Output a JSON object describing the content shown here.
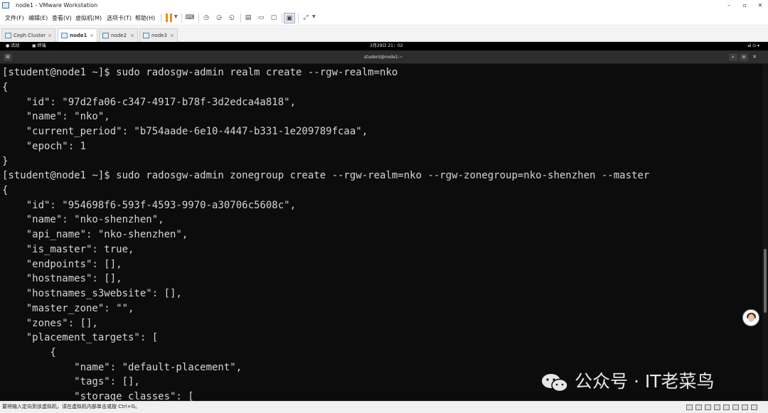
{
  "window": {
    "title": "node1 - VMware Workstation",
    "controls": {
      "minimize": "–",
      "maximize": "▫",
      "close": "✕"
    }
  },
  "menu": [
    {
      "label": "文件(F)"
    },
    {
      "label": "编辑(E)"
    },
    {
      "label": "查看(V)"
    },
    {
      "label": "虚拟机(M)"
    },
    {
      "label": "选项卡(T)"
    },
    {
      "label": "帮助(H)"
    }
  ],
  "toolbar": {
    "icons": [
      "pause-icon",
      "send-keys-icon",
      "snapshot-icon",
      "revert-snapshot-icon",
      "manage-snapshots-icon",
      "show-library-icon",
      "thumbnail-icon",
      "full-screen-view-icon",
      "console-view-icon",
      "fit-window-icon"
    ],
    "accent": "#e98b1b"
  },
  "tabs": [
    {
      "label": "Ceph Cluster",
      "close": "×",
      "active": false
    },
    {
      "label": "node1",
      "close": "×",
      "active": true
    },
    {
      "label": "node2",
      "close": "×",
      "active": false
    },
    {
      "label": "node3",
      "close": "×",
      "active": false
    }
  ],
  "gnome_bar": {
    "activities": "● 活动",
    "terminal_app": "▣ 终端",
    "clock": "3月29日 21：02",
    "status_icons": "◂) ⏻ ▾"
  },
  "terminal": {
    "title": "student@node1:~",
    "background": "#0c0c0c",
    "foreground": "#d3d7cf",
    "lines": [
      "[student@node1 ~]$ sudo radosgw-admin realm create --rgw-realm=nko",
      "{",
      "    \"id\": \"97d2fa06-c347-4917-b78f-3d2edca4a818\",",
      "    \"name\": \"nko\",",
      "    \"current_period\": \"b754aade-6e10-4447-b331-1e209789fcaa\",",
      "    \"epoch\": 1",
      "}",
      "[student@node1 ~]$ sudo radosgw-admin zonegroup create --rgw-realm=nko --rgw-zonegroup=nko-shenzhen --master",
      "{",
      "    \"id\": \"954698f6-593f-4593-9970-a30706c5608c\",",
      "    \"name\": \"nko-shenzhen\",",
      "    \"api_name\": \"nko-shenzhen\",",
      "    \"is_master\": true,",
      "    \"endpoints\": [],",
      "    \"hostnames\": [],",
      "    \"hostnames_s3website\": [],",
      "    \"master_zone\": \"\",",
      "    \"zones\": [],",
      "    \"placement_targets\": [",
      "        {",
      "            \"name\": \"default-placement\",",
      "            \"tags\": [],",
      "            \"storage_classes\": ["
    ]
  },
  "watermark": {
    "text": "公众号 · IT老菜鸟",
    "icon": "wechat-icon"
  },
  "statusbar": {
    "hint": "要将输入定向到该虚拟机，请在虚拟机内部单击或按 Ctrl+G。"
  }
}
